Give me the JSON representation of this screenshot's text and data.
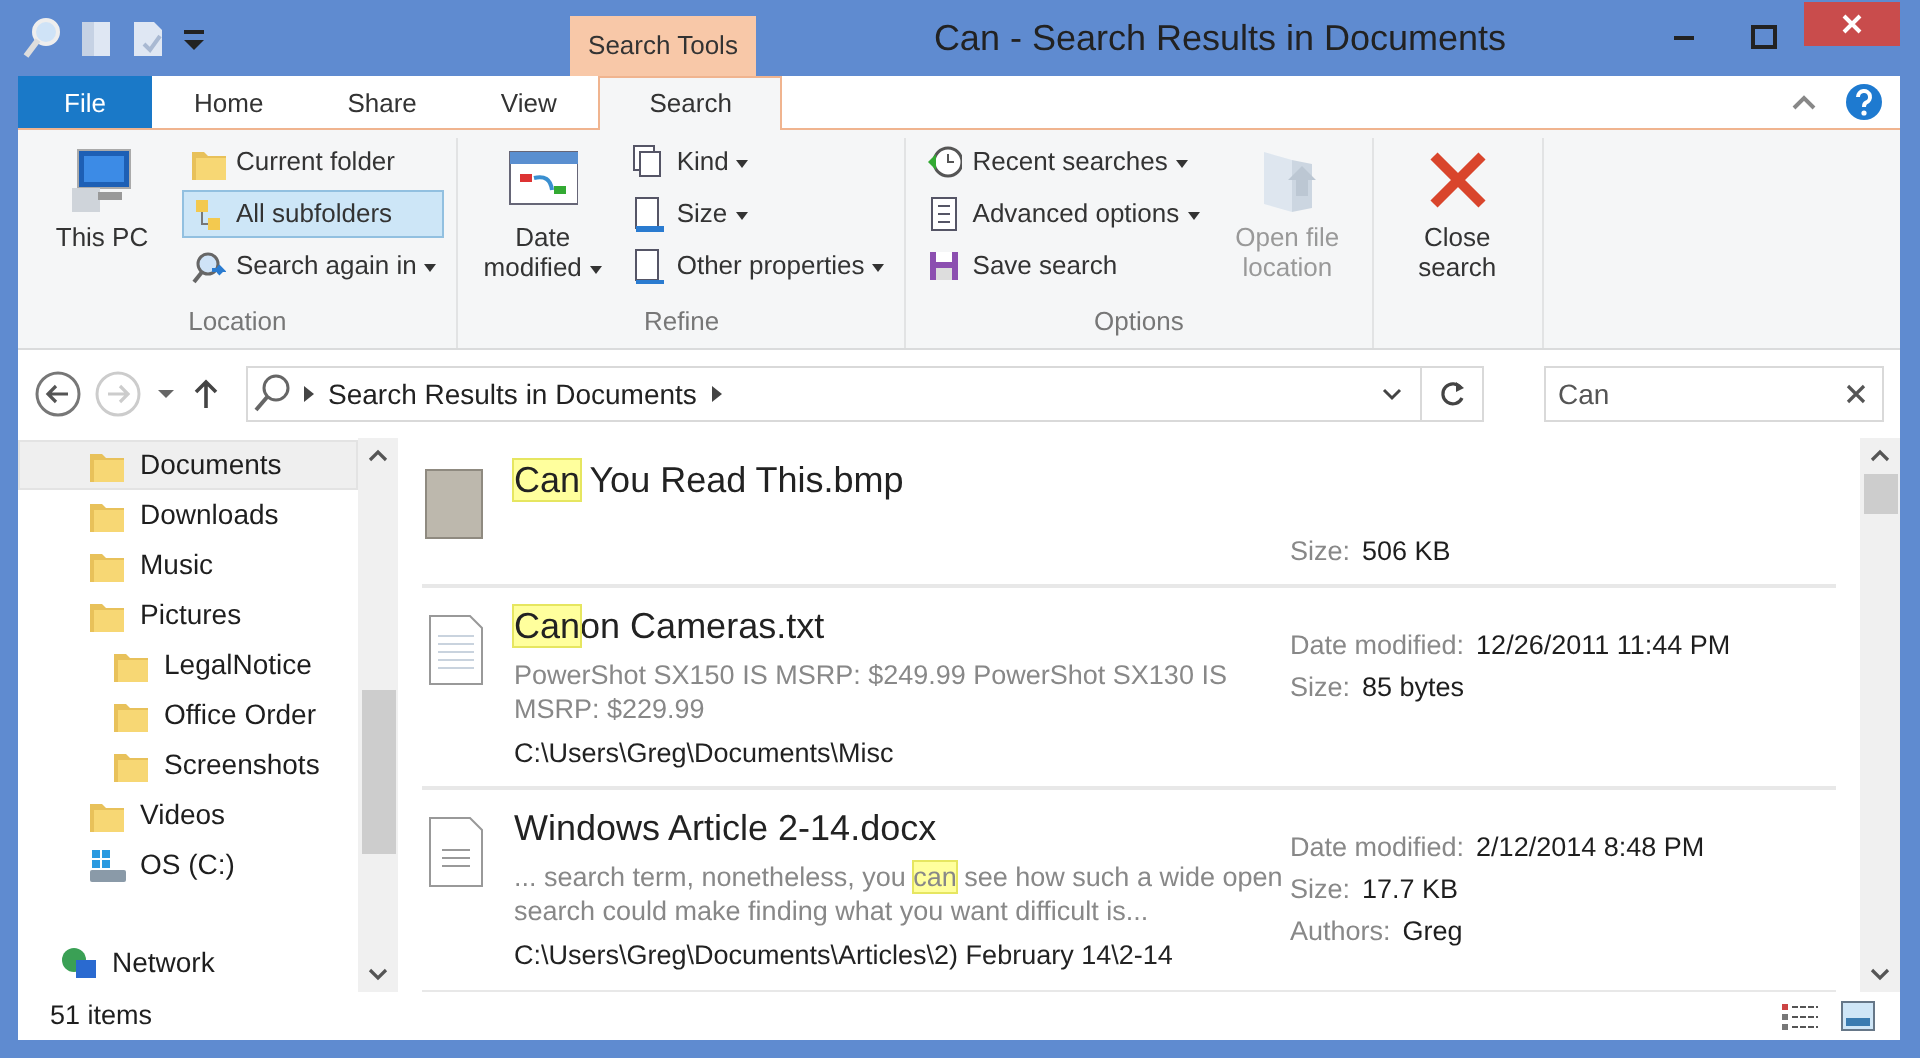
{
  "window": {
    "title": "Can - Search Results in Documents",
    "contextual_tab_group": "Search Tools"
  },
  "tabs": [
    {
      "label": "File",
      "kind": "file",
      "selected": false
    },
    {
      "label": "Home",
      "kind": "tab",
      "selected": false
    },
    {
      "label": "Share",
      "kind": "tab",
      "selected": false
    },
    {
      "label": "View",
      "kind": "tab",
      "selected": false
    },
    {
      "label": "Search",
      "kind": "contextual",
      "selected": true
    }
  ],
  "ribbon": {
    "groups": [
      {
        "label": "Location",
        "items": [
          {
            "kind": "big",
            "label": "This PC",
            "dropdown": false,
            "disabled": false
          },
          {
            "kind": "small",
            "label": "Current folder",
            "dropdown": false,
            "selected": false
          },
          {
            "kind": "small",
            "label": "All subfolders",
            "dropdown": false,
            "selected": true
          },
          {
            "kind": "small",
            "label": "Search again in",
            "dropdown": true,
            "selected": false
          }
        ]
      },
      {
        "label": "Refine",
        "items": [
          {
            "kind": "big",
            "label": "Date modified",
            "dropdown": true,
            "disabled": false
          },
          {
            "kind": "small",
            "label": "Kind",
            "dropdown": true,
            "selected": false
          },
          {
            "kind": "small",
            "label": "Size",
            "dropdown": true,
            "selected": false
          },
          {
            "kind": "small",
            "label": "Other properties",
            "dropdown": true,
            "selected": false
          }
        ]
      },
      {
        "label": "Options",
        "items": [
          {
            "kind": "small",
            "label": "Recent searches",
            "dropdown": true,
            "selected": false
          },
          {
            "kind": "small",
            "label": "Advanced options",
            "dropdown": true,
            "selected": false
          },
          {
            "kind": "small",
            "label": "Save search",
            "dropdown": false,
            "selected": false
          },
          {
            "kind": "big",
            "label": "Open file location",
            "dropdown": false,
            "disabled": true
          }
        ]
      },
      {
        "items": [
          {
            "kind": "big",
            "label": "Close search",
            "dropdown": false,
            "disabled": false
          }
        ]
      }
    ]
  },
  "address_bar": {
    "crumbs": [
      "Search Results in Documents"
    ]
  },
  "search": {
    "value": "Can"
  },
  "nav_pane": {
    "items": [
      {
        "label": "Documents",
        "kind": "folder",
        "selected": true
      },
      {
        "label": "Downloads",
        "kind": "folder",
        "selected": false
      },
      {
        "label": "Music",
        "kind": "folder",
        "selected": false
      },
      {
        "label": "Pictures",
        "kind": "folder",
        "selected": false,
        "children": [
          {
            "label": "LegalNotice",
            "kind": "folder",
            "selected": false
          },
          {
            "label": "Office Order",
            "kind": "folder",
            "selected": false
          },
          {
            "label": "Screenshots",
            "kind": "folder",
            "selected": false
          }
        ]
      },
      {
        "label": "Videos",
        "kind": "folder",
        "selected": false
      },
      {
        "label": "OS (C:)",
        "kind": "drive",
        "selected": false
      },
      {
        "label": "Network",
        "kind": "network",
        "selected": false
      }
    ]
  },
  "results": [
    {
      "kind": "image",
      "name": [
        {
          "text": "Can",
          "match": true
        },
        {
          "text": " You Read This.bmp",
          "match": false
        }
      ],
      "properties": [
        {
          "label": "Size:",
          "value": "506 KB"
        }
      ]
    },
    {
      "kind": "text",
      "name": [
        {
          "text": "Can",
          "match": true
        },
        {
          "text": "on Cameras.txt",
          "match": false
        }
      ],
      "snippet": [
        {
          "text": "PowerShot SX150 IS MSRP: $249.99 PowerShot SX130 IS MSRP: $229.99",
          "match": false
        }
      ],
      "path": "C:\\Users\\Greg\\Documents\\Misc",
      "properties": [
        {
          "label": "Date modified:",
          "value": "12/26/2011 11:44 PM"
        },
        {
          "label": "Size:",
          "value": "85 bytes"
        }
      ]
    },
    {
      "kind": "document",
      "name": [
        {
          "text": "Windows Article 2-14.docx",
          "match": false
        }
      ],
      "snippet": [
        {
          "text": "... search term, nonetheless, you ",
          "match": false
        },
        {
          "text": "can",
          "match": true
        },
        {
          "text": " see how such a wide open search could make finding what you want difficult is...",
          "match": false
        }
      ],
      "path": "C:\\Users\\Greg\\Documents\\Articles\\2) February 14\\2-14",
      "properties": [
        {
          "label": "Date modified:",
          "value": "2/12/2014 8:48 PM"
        },
        {
          "label": "Size:",
          "value": "17.7 KB"
        },
        {
          "label": "Authors:",
          "value": "Greg"
        }
      ]
    }
  ],
  "status_bar": {
    "item_count": "51 items"
  }
}
